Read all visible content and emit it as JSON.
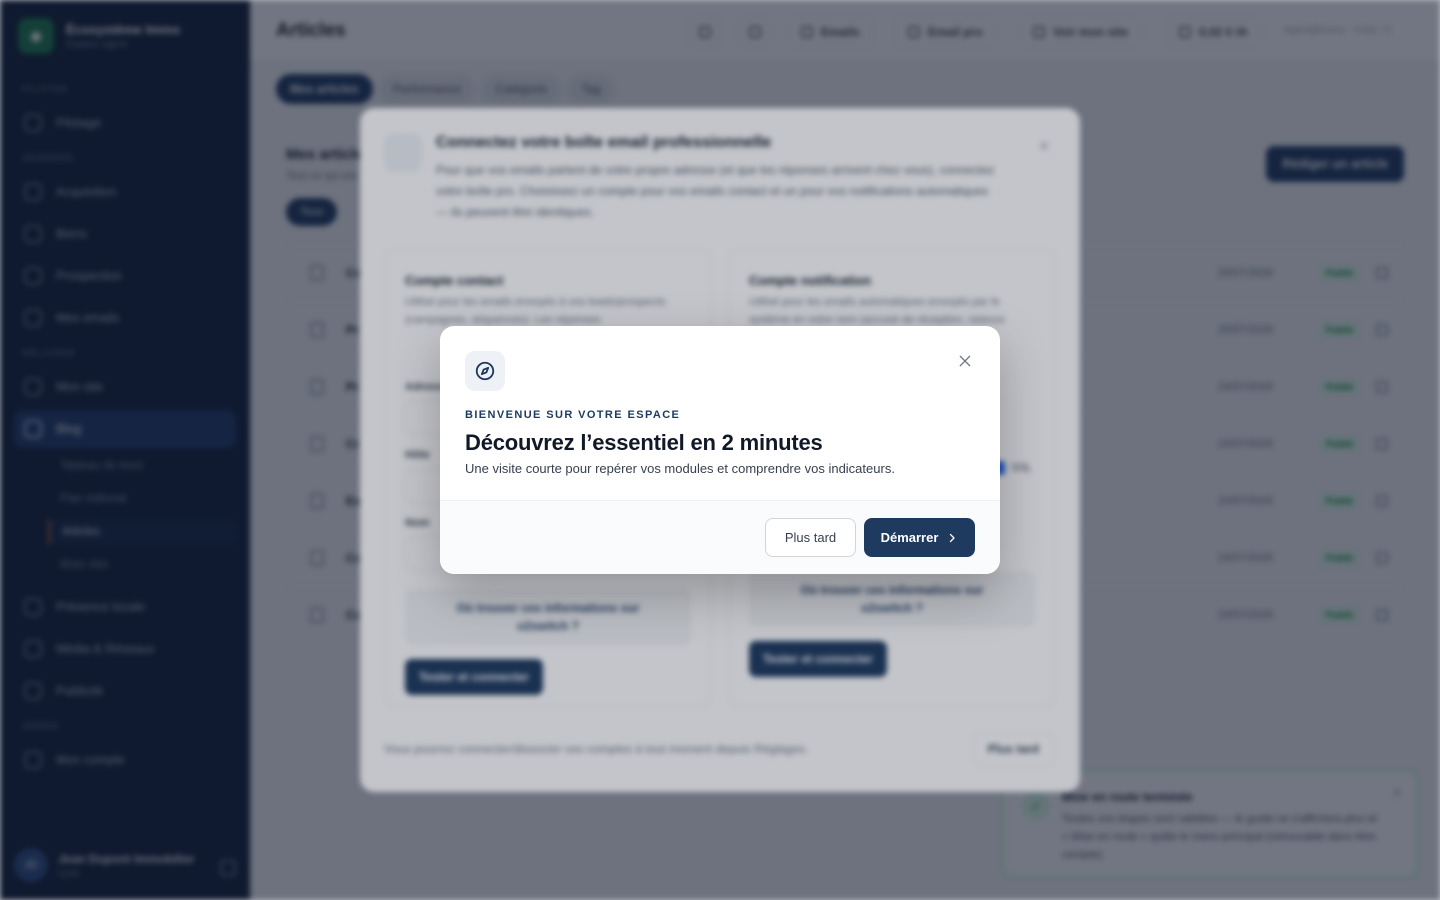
{
  "sidebar": {
    "brand_title": "Écosystème Immo",
    "brand_sub": "Espace agent",
    "sections": [
      "PILOTER",
      "GÉNÉRER",
      "DÉLIVRER",
      "GÉRER"
    ],
    "items": [
      {
        "label": "Pilotage",
        "icon": "gauge-icon"
      },
      {
        "label": "Acquisition",
        "icon": "inbox-icon"
      },
      {
        "label": "Biens",
        "icon": "home-icon"
      },
      {
        "label": "Prospection",
        "icon": "target-icon"
      },
      {
        "label": "Mes emails",
        "icon": "mail-icon"
      },
      {
        "label": "Mon site",
        "icon": "globe-icon"
      },
      {
        "label": "Blog",
        "icon": "newspaper-icon"
      },
      {
        "label": "Présence locale",
        "icon": "map-pin-icon"
      },
      {
        "label": "Média & Réseaux",
        "icon": "share-icon"
      },
      {
        "label": "Publicité",
        "icon": "megaphone-icon"
      },
      {
        "label": "Mon compte",
        "icon": "user-icon"
      }
    ],
    "blog_sub": [
      "Tableau de bord",
      "Plan éditorial",
      "Articles",
      "Mots clés"
    ],
    "user_initials": "JD",
    "user_name": "Jean Dupont Immobilier",
    "user_city": "Lyon"
  },
  "topbar": {
    "title": "Articles",
    "emails": "Emails",
    "email_pro": "Email pro",
    "site": "Voir mon site",
    "credits": "0,02 € IA",
    "agent": "Agent@Immo · Créd. 71"
  },
  "tabs": [
    "Mes articles",
    "Performance",
    "Catégorie",
    "Tag"
  ],
  "articles": {
    "title": "Mes articles",
    "subtitle": "Tout ce qui est publié",
    "new_button": "Rédiger un article",
    "filter": "Tous",
    "rows": [
      {
        "title": "Co",
        "date": "29/07/2026",
        "status": "Publié"
      },
      {
        "title": "Pr",
        "date": "29/07/2026",
        "status": "Publié"
      },
      {
        "title": "Pr",
        "date": "24/07/2026",
        "status": "Publié"
      },
      {
        "title": "Cr",
        "date": "24/07/2026",
        "status": "Publié"
      },
      {
        "title": "Es",
        "date": "24/07/2026",
        "status": "Publié"
      },
      {
        "title": "Co",
        "date": "24/07/2026",
        "status": "Publié"
      },
      {
        "title": "Co",
        "date": "24/07/2026",
        "status": "Publié"
      }
    ]
  },
  "email_modal": {
    "title": "Connectez votre boîte email professionnelle",
    "description": "Pour que vos emails partent de votre propre adresse (et que les réponses arrivent chez vous), connectez votre boîte pro. Choisissez un compte pour vos emails contact et un pour vos notifications automatiques — ils peuvent être identiques.",
    "contact_title": "Compte contact",
    "contact_desc": "Utilisé pour les emails envoyés à vos leads/prospects (campagnes, séquences). Les réponses",
    "notif_title": "Compte notification",
    "notif_desc": "Utilisé pour les emails automatiques envoyés par le système en votre nom (accusé de réception, relance",
    "field_address": "Adresse",
    "field_host": "Hôte",
    "field_name": "Nom",
    "ssl": "SSL",
    "help": "Où trouver ces informations sur o2switch ?",
    "connect": "Tester et connecter",
    "footer": "Vous pourrez connecter/dissocier ces comptes à tout moment depuis Réglages.",
    "later": "Plus tard"
  },
  "toast": {
    "title": "Mise en route terminée",
    "body": "Toutes vos étapes sont validées — le guide ne s'affichera plus et « Mise en route » quitte le menu principal (retrouvable dans Mon compte)."
  },
  "tour": {
    "icon": "compass-icon",
    "eyebrow": "BIENVENUE SUR VOTRE ESPACE",
    "title": "Découvrez l’essentiel en 2 minutes",
    "description": "Une visite courte pour repérer vos modules et comprendre vos indicateurs.",
    "later_label": "Plus tard",
    "start_label": "Démarrer"
  },
  "colors": {
    "primary": "#1e3a5f",
    "sidebar": "#0f1e36",
    "success": "#15803d"
  }
}
